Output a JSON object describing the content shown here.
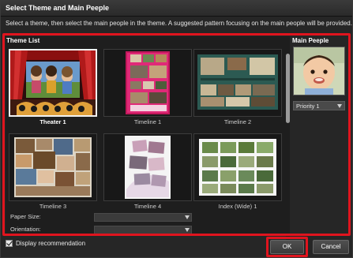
{
  "window": {
    "title": "Select Theme and Main Peeple",
    "instruction": "Select a theme, then select the main people in the theme. A suggested pattern focusing on the main people will be provided."
  },
  "theme_list": {
    "heading": "Theme List",
    "selected": "Theater 1",
    "tiles": [
      {
        "label": "Theater 1"
      },
      {
        "label": "Timeline 1"
      },
      {
        "label": "Timeline 2"
      },
      {
        "label": "Timeline 3"
      },
      {
        "label": "Timeline 4"
      },
      {
        "label": "Index (Wide) 1"
      }
    ]
  },
  "settings": {
    "paper_size_label": "Paper Size:",
    "orientation_label": "Orientation:"
  },
  "main_people": {
    "heading": "Main Peeple",
    "priority_value": "Priority 1"
  },
  "footer": {
    "display_recommendation_label": "Display recommendation",
    "display_recommendation_checked": true,
    "ok_label": "OK",
    "cancel_label": "Cancel"
  },
  "colors": {
    "highlight": "#e0141e",
    "background": "#262626",
    "panel": "#1e1e1e"
  }
}
